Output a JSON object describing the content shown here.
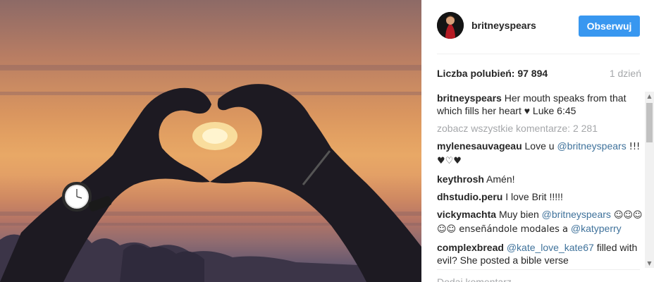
{
  "post": {
    "photo_alt": "heart hands at sunset",
    "author": "britneyspears",
    "follow_label": "Obserwuj",
    "likes_label": "Liczba polubień: 97 894",
    "time_ago": "1 dzień",
    "caption": {
      "user": "britneyspears",
      "text": "Her mouth speaks from that which fills her heart ♥ Luke 6:45"
    },
    "view_all_comments": "zobacz wszystkie komentarze: 2 281",
    "comments": [
      {
        "user": "mylenesauvageau",
        "pre": "Love u",
        "mention": "@britneyspears",
        "post": "!!! ♥♡♥"
      },
      {
        "user": "keythrosh",
        "pre": "Amén!",
        "mention": "",
        "post": ""
      },
      {
        "user": "dhstudio.peru",
        "pre": "I love Brit !!!!!",
        "mention": "",
        "post": ""
      },
      {
        "user": "vickymachta",
        "pre": "Muy bien",
        "mention": "@britneyspears",
        "post": "☺☺☺☺☺ enseñándole modales a",
        "mention2": "@katyperry"
      },
      {
        "user": "complexbread",
        "pre": "",
        "mention": "@kate_love_kate67",
        "post": "filled with evil? She posted a bible verse"
      }
    ],
    "add_comment_placeholder": "Dodaj komentarz..."
  },
  "icons": {
    "scroll_up": "scroll-up-arrow-icon",
    "scroll_down": "scroll-down-arrow-icon"
  },
  "colors": {
    "follow_button": "#3897f0",
    "mention": "#3f729b",
    "muted": "#a5a7aa"
  }
}
